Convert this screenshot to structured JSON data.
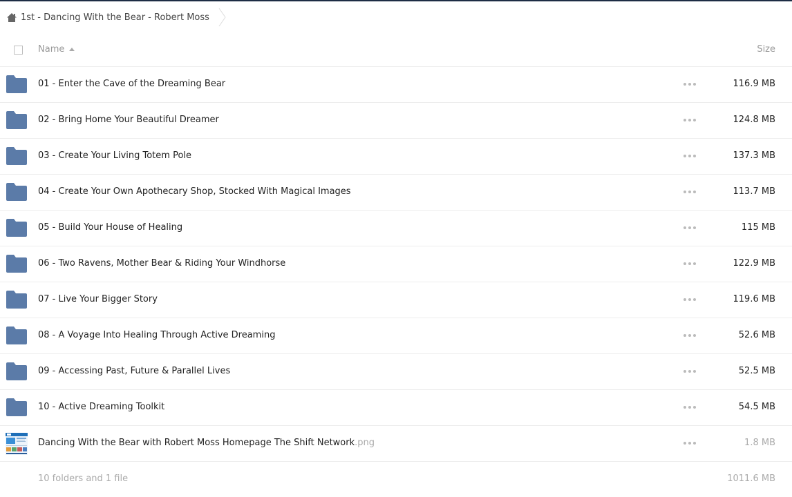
{
  "breadcrumb": {
    "home_icon": "home-icon",
    "current": "1st - Dancing With the Bear - Robert Moss"
  },
  "header": {
    "name_label": "Name",
    "size_label": "Size"
  },
  "colors": {
    "folder": "#5b7ba8",
    "top_bar": "#1d2d44",
    "muted_text": "#aaaaaa"
  },
  "folders": [
    {
      "name": "01 - Enter the Cave of the Dreaming Bear",
      "size": "116.9 MB"
    },
    {
      "name": "02 - Bring Home Your Beautiful Dreamer",
      "size": "124.8 MB"
    },
    {
      "name": "03 - Create Your Living Totem Pole",
      "size": "137.3 MB"
    },
    {
      "name": "04 - Create Your Own Apothecary Shop, Stocked With Magical Images",
      "size": "113.7 MB"
    },
    {
      "name": "05 - Build Your House of Healing",
      "size": "115 MB"
    },
    {
      "name": "06 - Two Ravens, Mother Bear & Riding Your Windhorse",
      "size": "122.9 MB"
    },
    {
      "name": "07 - Live Your Bigger Story",
      "size": "119.6 MB"
    },
    {
      "name": "08 - A Voyage Into Healing Through Active Dreaming",
      "size": "52.6 MB"
    },
    {
      "name": "09 - Accessing Past, Future & Parallel Lives",
      "size": "52.5 MB"
    },
    {
      "name": "10 - Active Dreaming Toolkit",
      "size": "54.5 MB"
    }
  ],
  "file": {
    "name": "Dancing With the Bear with Robert Moss Homepage The Shift Network",
    "ext": ".png",
    "size": "1.8 MB"
  },
  "summary": {
    "count": "10 folders and 1 file",
    "total": "1011.6 MB"
  }
}
